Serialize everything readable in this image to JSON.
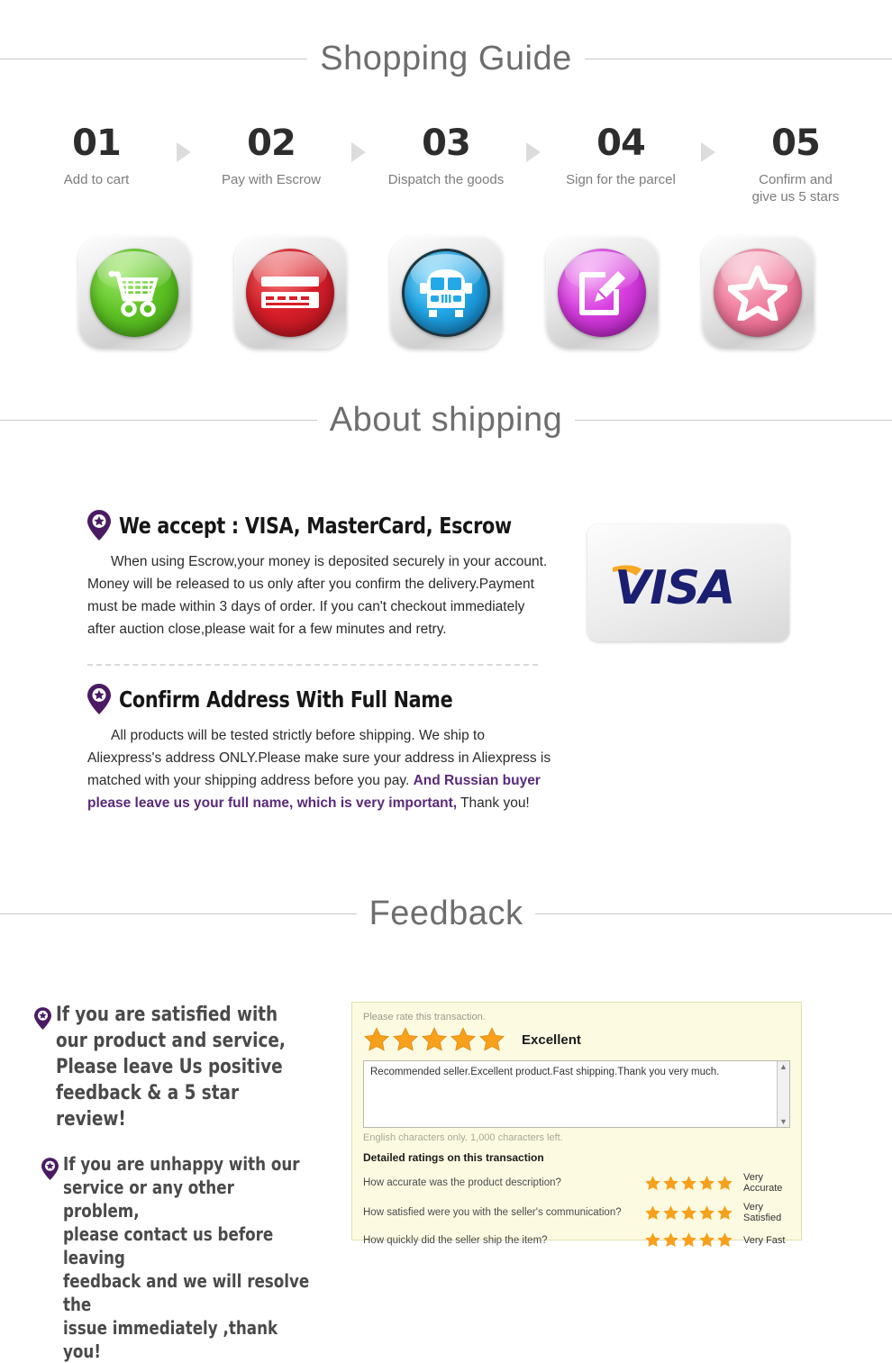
{
  "sections": {
    "shopping_guide": "Shopping Guide",
    "about_shipping": "About shipping",
    "feedback": "Feedback"
  },
  "steps": [
    {
      "num": "01",
      "label": "Add to cart",
      "icon": "shopping-cart-icon"
    },
    {
      "num": "02",
      "label": "Pay with Escrow",
      "icon": "credit-card-icon"
    },
    {
      "num": "03",
      "label": "Dispatch the goods",
      "icon": "delivery-bus-icon"
    },
    {
      "num": "04",
      "label": "Sign for the parcel",
      "icon": "edit-pencil-icon"
    },
    {
      "num": "05",
      "label": "Confirm and\ngive us 5 stars",
      "icon": "star-icon"
    }
  ],
  "shipping": {
    "accept_heading": "We accept : VISA, MasterCard, Escrow",
    "accept_body": "When using Escrow,your money is deposited securely in your account. Money will be released to us only after you confirm the delivery.Payment must be made within 3 days of order. If you can't checkout immediately after auction close,please wait for a few minutes and retry.",
    "address_heading": "Confirm Address With Full Name",
    "address_body_plain_1": "All products will be tested strictly before shipping. We ship to Aliexpress's address ONLY.Please make sure your address in Aliexpress is matched with your shipping address before you pay. ",
    "address_body_highlight": "And Russian buyer please leave us your full name, which is very important,",
    "address_body_plain_2": " Thank you!",
    "visa_logo_text": "VISA"
  },
  "feedback": {
    "positive_text": "If you are satisfied with\nour product and service,\nPlease leave Us positive\nfeedback & a 5 star review!",
    "unhappy_text": "If you are unhappy with our\nservice or any other problem,\nplease contact us before leaving\nfeedback and we will resolve the\nissue immediately ,thank you!",
    "panel": {
      "rate_prompt": "Please rate this transaction.",
      "rating_label": "Excellent",
      "star_count": 5,
      "review_text": "Recommended seller.Excellent product.Fast shipping.Thank you very much.",
      "char_note": "English characters only. 1,000 characters left.",
      "detailed_title": "Detailed ratings on this transaction",
      "detailed_rows": [
        {
          "question": "How accurate was the product description?",
          "stars": 5,
          "value": "Very Accurate"
        },
        {
          "question": "How satisfied were you with the seller's communication?",
          "stars": 5,
          "value": "Very Satisfied"
        },
        {
          "question": "How quickly did the seller ship the item?",
          "stars": 5,
          "value": "Very Fast"
        }
      ]
    }
  },
  "colors": {
    "header_gray": "#6e6e6e",
    "purple_accent": "#5a2a7a",
    "star_orange": "#f7a01c",
    "panel_bg": "#fcfbe2",
    "visa_blue": "#1a1f71",
    "visa_orange": "#f7a823"
  }
}
